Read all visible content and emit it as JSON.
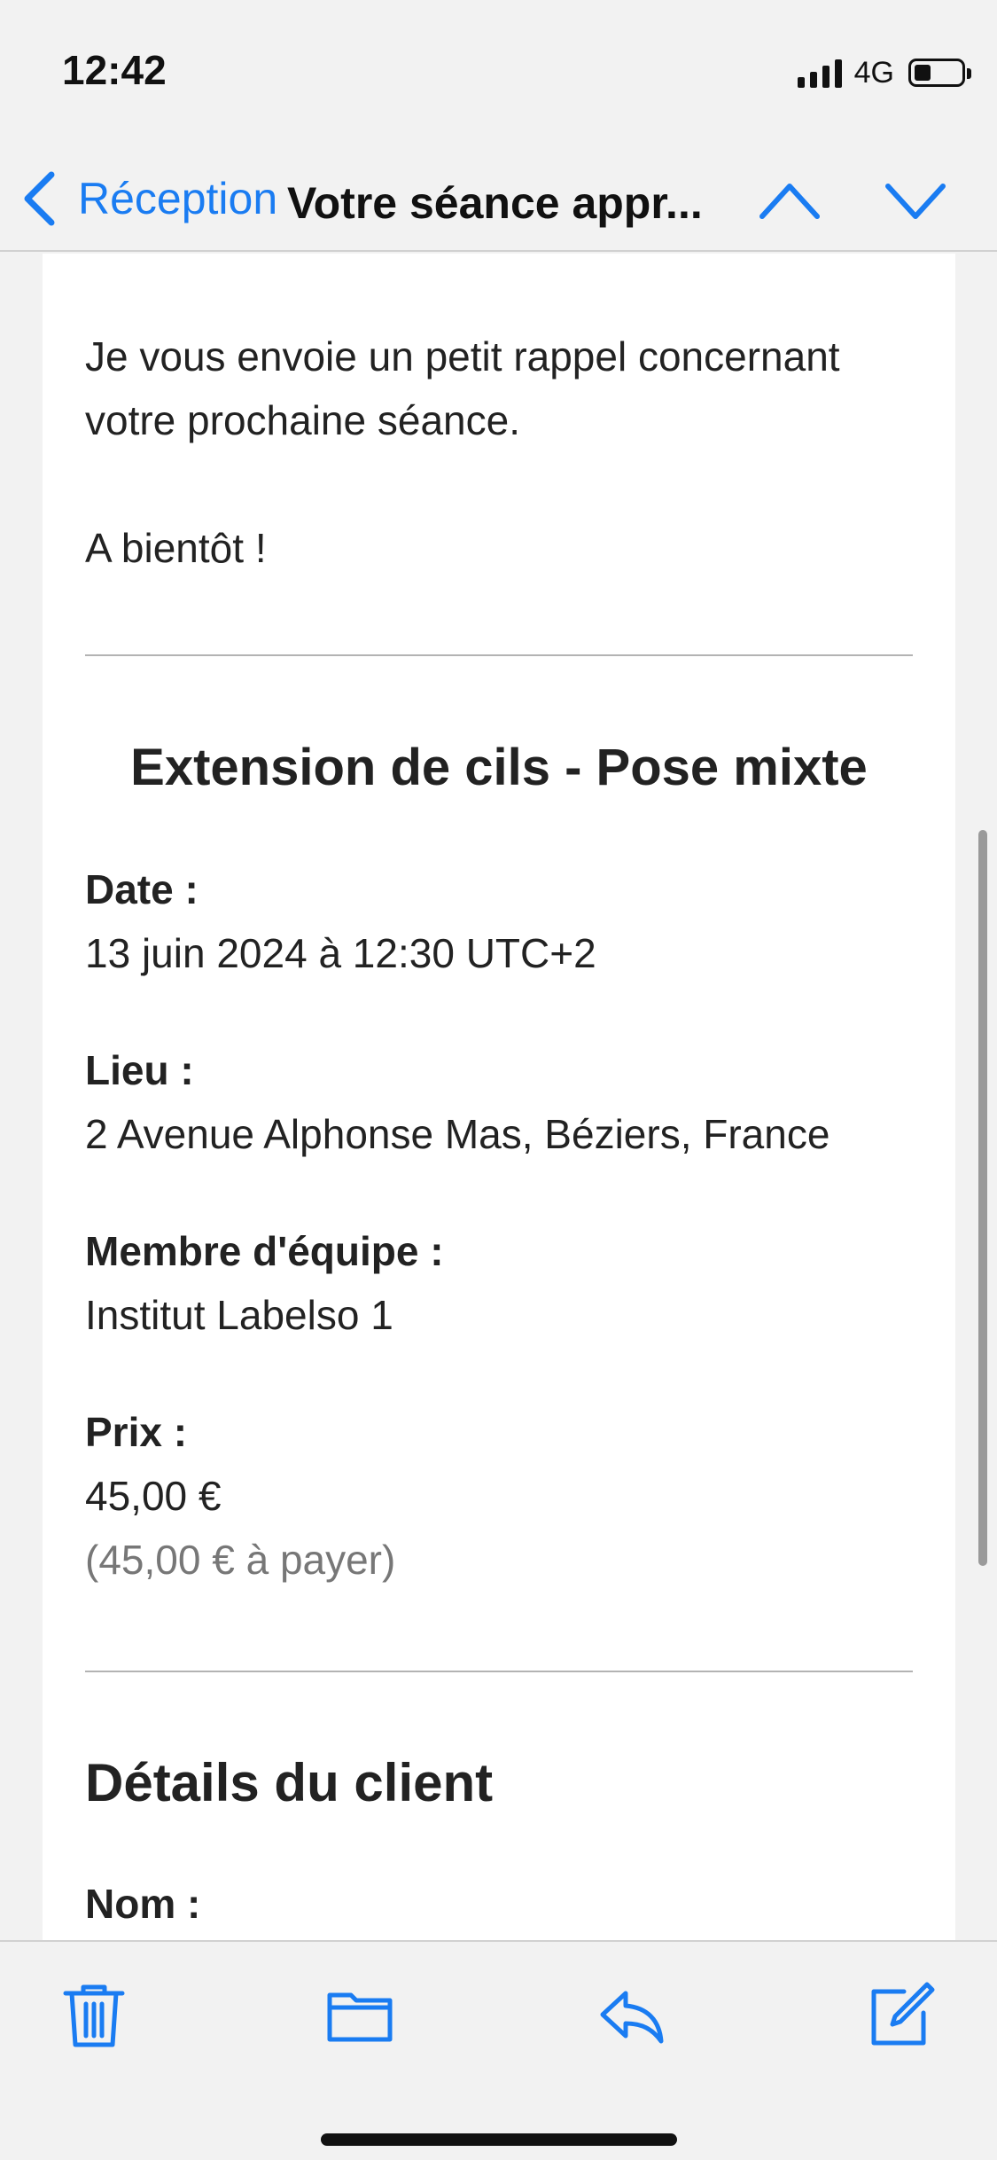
{
  "status_bar": {
    "time": "12:42",
    "network": "4G",
    "battery_level": 0.35
  },
  "nav": {
    "back_label": "Réception",
    "title": "Votre séance appr..."
  },
  "email": {
    "intro": "Je vous envoie un petit rappel concernant votre prochaine séance.",
    "greeting": "A bientôt !",
    "service_title": "Extension de cils - Pose mixte",
    "fields": [
      {
        "label": "Date :",
        "value": "13 juin 2024 à 12:30 UTC+2"
      },
      {
        "label": "Lieu :",
        "value": "2 Avenue Alphonse Mas, Béziers, France"
      },
      {
        "label": "Membre d'équipe :",
        "value": "Institut Labelso 1"
      },
      {
        "label": "Prix :",
        "value": "45,00 €",
        "note": "(45,00 € à payer)"
      }
    ],
    "client_section_title": "Détails du client",
    "client_fields": [
      {
        "label": "Nom :"
      }
    ]
  },
  "toolbar": {
    "icons": [
      "trash-icon",
      "folder-icon",
      "reply-icon",
      "compose-icon"
    ]
  },
  "colors": {
    "accent": "#1a7cf2",
    "text": "#222222",
    "muted": "#777777",
    "background": "#f2f2f2"
  }
}
